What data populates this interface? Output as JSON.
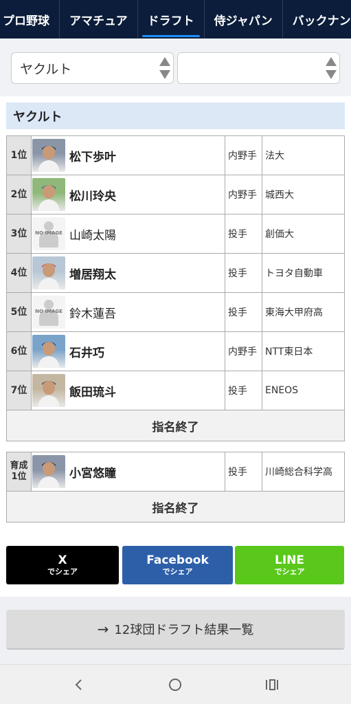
{
  "nav": {
    "tabs": [
      {
        "label": "プロ野球",
        "active": false
      },
      {
        "label": "アマチュア",
        "active": false
      },
      {
        "label": "ドラフト",
        "active": true
      },
      {
        "label": "侍ジャパン",
        "active": false
      },
      {
        "label": "バックナンバー",
        "active": false
      }
    ]
  },
  "filters": {
    "team_select": "ヤクルト",
    "second_select": ""
  },
  "team": {
    "name": "ヤクルト"
  },
  "picks": [
    {
      "rank": "1位",
      "name": "松下歩叶",
      "position": "内野手",
      "school": "法大",
      "photo": "player-photo",
      "bold": true
    },
    {
      "rank": "2位",
      "name": "松川玲央",
      "position": "内野手",
      "school": "城西大",
      "photo": "player-photo",
      "bold": true
    },
    {
      "rank": "3位",
      "name": "山崎太陽",
      "position": "投手",
      "school": "創価大",
      "photo": "no-image",
      "bold": false
    },
    {
      "rank": "4位",
      "name": "増居翔太",
      "position": "投手",
      "school": "トヨタ自動車",
      "photo": "player-photo",
      "bold": true
    },
    {
      "rank": "5位",
      "name": "鈴木蓮吾",
      "position": "投手",
      "school": "東海大甲府高",
      "photo": "no-image",
      "bold": false
    },
    {
      "rank": "6位",
      "name": "石井巧",
      "position": "内野手",
      "school": "NTT東日本",
      "photo": "player-photo",
      "bold": true
    },
    {
      "rank": "7位",
      "name": "飯田琉斗",
      "position": "投手",
      "school": "ENEOS",
      "photo": "player-photo",
      "bold": true
    }
  ],
  "picks_end_label": "指名終了",
  "development_picks": [
    {
      "rank": "育成1位",
      "name": "小宮悠瞳",
      "position": "投手",
      "school": "川崎総合科学高",
      "photo": "player-photo",
      "bold": true
    }
  ],
  "development_end_label": "指名終了",
  "no_image_label": "NO IMAGE",
  "share": {
    "x": {
      "title": "X",
      "sub": "でシェア",
      "color": "#000000"
    },
    "facebook": {
      "title": "Facebook",
      "sub": "でシェア",
      "color": "#2d5fa9"
    },
    "line": {
      "title": "LINE",
      "sub": "でシェア",
      "color": "#5ac81b"
    }
  },
  "results_link": {
    "label": "12球団ドラフト結果一覧",
    "icon": "arrow-right-icon"
  },
  "android_nav": {
    "back": "back-icon",
    "home": "home-icon",
    "recents": "recents-icon"
  }
}
